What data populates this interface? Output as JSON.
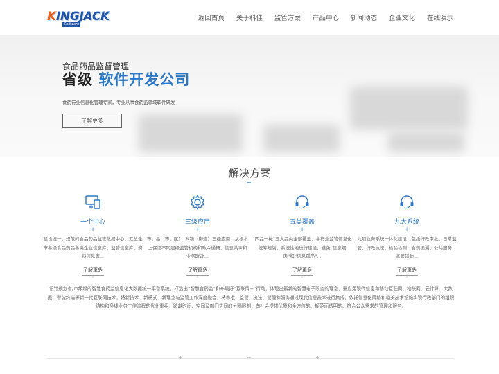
{
  "header": {
    "logo": {
      "brand_first": "K",
      "brand_rest": "INGJACK",
      "sub": "Software"
    },
    "nav": [
      "返回首页",
      "关于科佳",
      "监管方案",
      "产品中心",
      "新闻动态",
      "企业文化",
      "在线演示"
    ]
  },
  "banner": {
    "subtitle": "食品药品监督管理",
    "title_prefix": "省级",
    "title_highlight": "软件开发公司",
    "desc": "食药行业信息化管理专家，专业从事食药监领域软件研发",
    "button": "了解更多"
  },
  "solutions": {
    "title": "解决方案",
    "items": [
      {
        "icon": "monitor-icon",
        "title": "一个中心",
        "desc": "建设统一、规范的食品药品监管数据中心，汇总全市各级食品药品各类企业信息库、监管信息库、资料信息库...",
        "more": "了解更多"
      },
      {
        "icon": "gear-icon",
        "title": "三级应用",
        "desc": "市、县（市、区）、乡镇（街道）三级应用，从根本上保证不同层级监管机构和政令通畅、信息共享和业务联动...",
        "more": "了解更多"
      },
      {
        "icon": "headset-icon",
        "title": "五类覆盖",
        "desc": "“四品一械”五大品类全部覆盖，各行业监管信息化统筹规划、系统性地进行建设，避免“信息烟囱”和“信息孤岛”...",
        "more": "了解更多"
      },
      {
        "icon": "headset-icon",
        "title": "九大系统",
        "desc": "九项业务系统一体化建设，包括行政审批、日常监管、行政执法、检验检测、食药追溯、公共服务、监管辅助...",
        "more": "了解更多"
      }
    ]
  },
  "intro": "设计规划省/市级级的智慧食药监信息化大数据统一平台系统，打造出“智慧食药监”和布局好“互联网+”行动，体现出最新的智慧电子政务的理念，需应用现代信息和移动互联网、物联网、云计算、大数据、智能终端等新一代互联网技术，将新技术、新模式、新理念与监管工作深度融合，将审批、监管、执法、管理和服务通过现代信息技术进行集成，依托信息化网络和相关技术设施实现行政部门的组织结构和多线业务工作流程的优化重组，跨越时间、空间及部门之间的分隔限制，向社会提供优质和全方位的、规范而透明的、符合公众需求的管理和服务。",
  "colors": {
    "accent": "#2a78c6",
    "logo_orange": "#e2621f",
    "logo_blue": "#1f54a8"
  }
}
